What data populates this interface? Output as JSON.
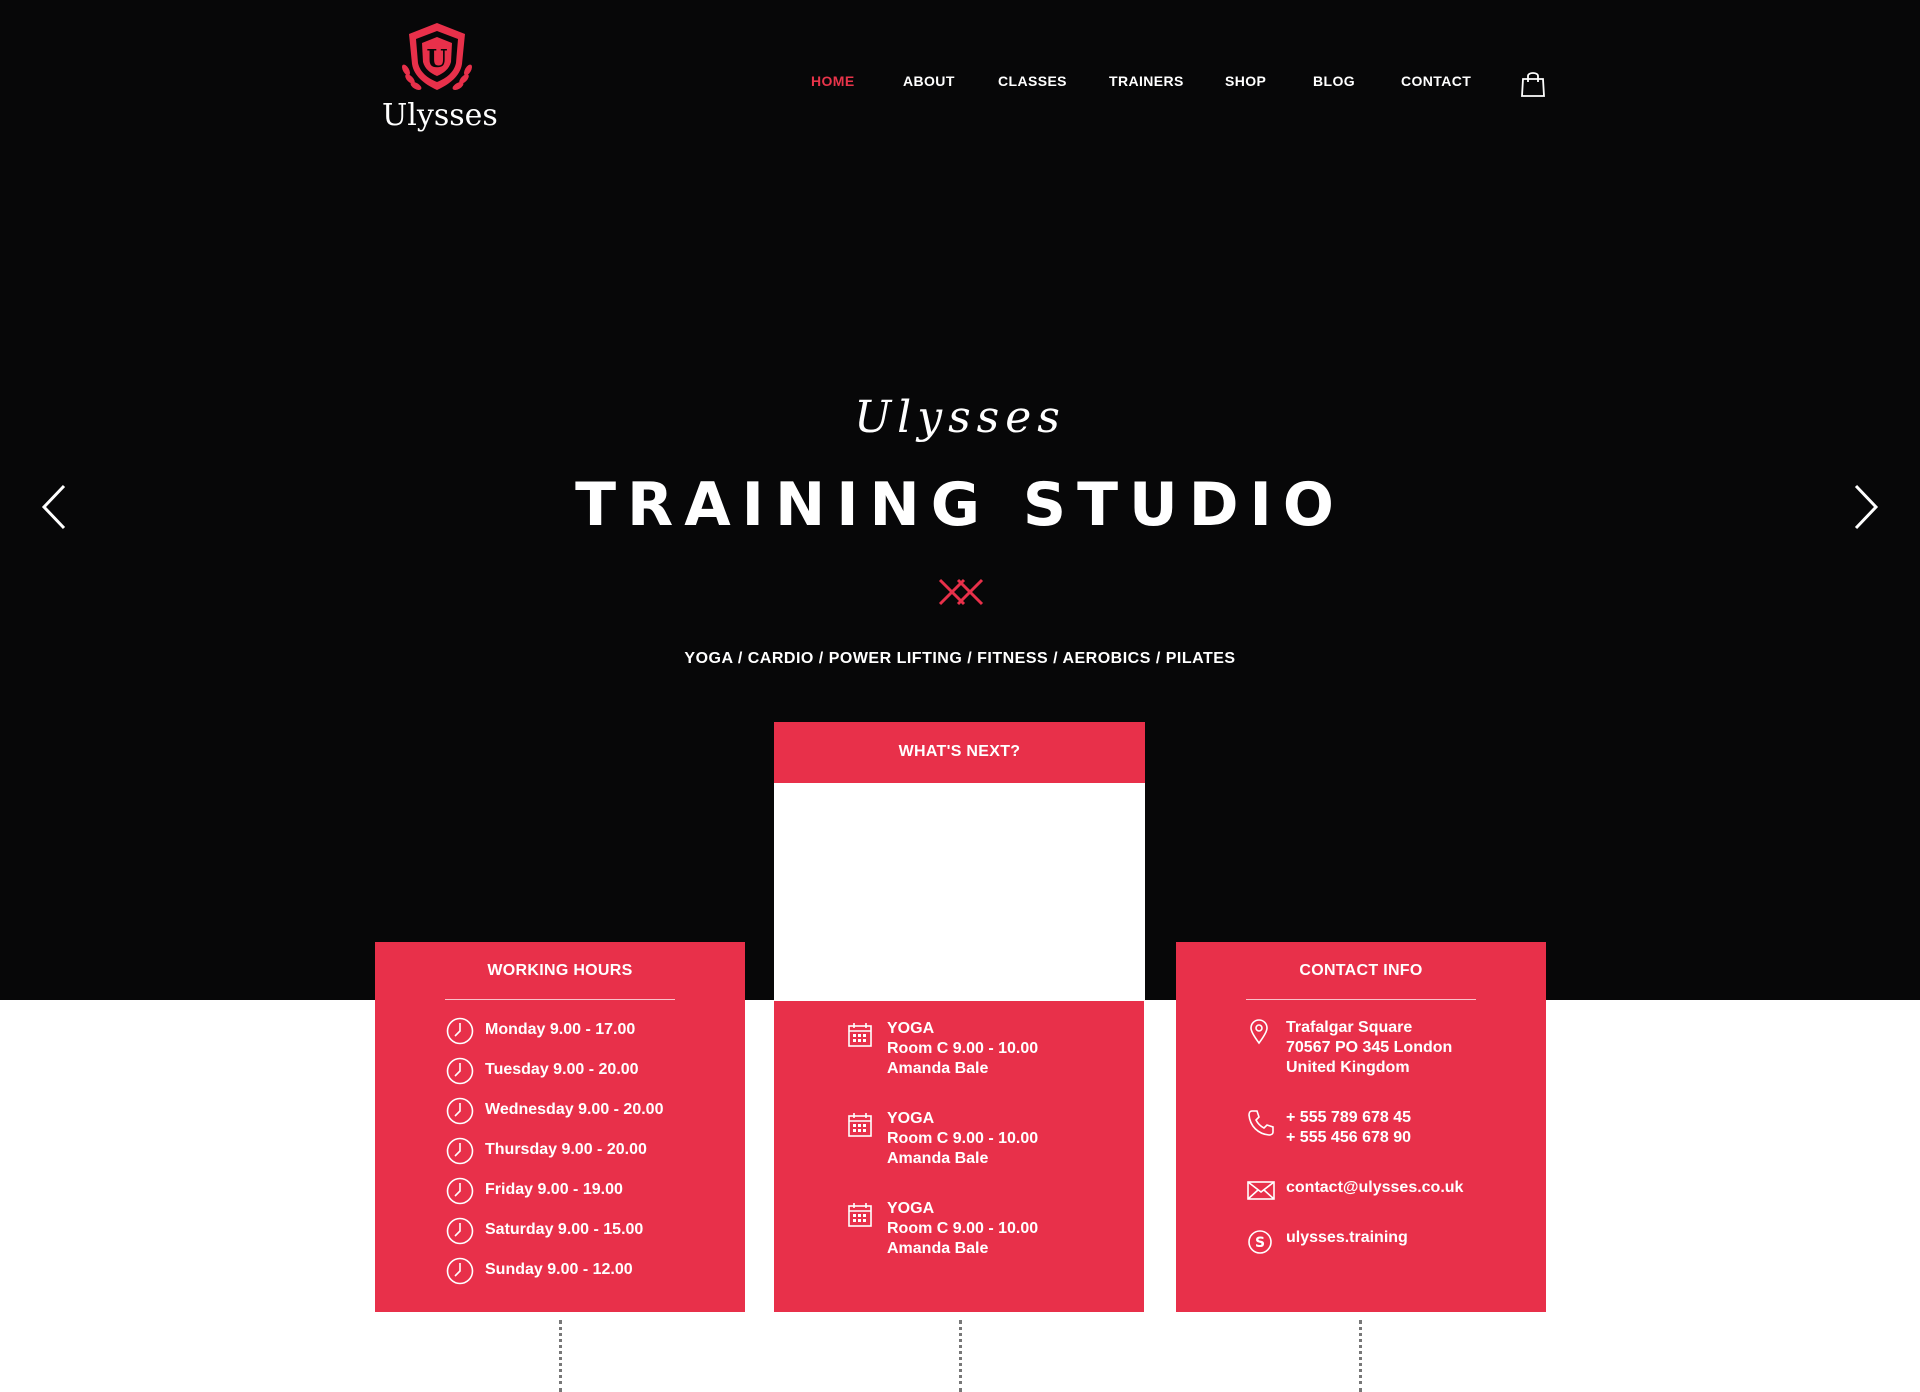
{
  "brand": {
    "logo_letter": "U",
    "name": "Ulysses"
  },
  "nav": {
    "items": [
      {
        "label": "HOME",
        "active": true
      },
      {
        "label": "ABOUT",
        "active": false
      },
      {
        "label": "CLASSES",
        "active": false
      },
      {
        "label": "TRAINERS",
        "active": false
      },
      {
        "label": "SHOP",
        "active": false
      },
      {
        "label": "BLOG",
        "active": false
      },
      {
        "label": "CONTACT",
        "active": false
      }
    ],
    "cart_icon": "shopping-bag-icon"
  },
  "hero": {
    "script_title": "Ulysses",
    "title": "TRAINING STUDIO",
    "subtitle": "YOGA / CARDIO / POWER LIFTING / FITNESS / AEROBICS  / PILATES",
    "prev_icon": "chevron-left-icon",
    "next_icon": "chevron-right-icon"
  },
  "working_hours": {
    "title": "WORKING HOURS",
    "items": [
      "Monday 9.00 - 17.00",
      "Tuesday 9.00 - 20.00",
      "Wednesday 9.00 - 20.00",
      "Thursday 9.00 - 20.00",
      "Friday 9.00 - 19.00",
      "Saturday 9.00 - 15.00",
      "Sunday 9.00 - 12.00"
    ]
  },
  "whats_next": {
    "title": "WHAT'S NEXT?",
    "events": [
      {
        "class": "YOGA",
        "room": "Room C 9.00 - 10.00",
        "trainer": "Amanda Bale"
      },
      {
        "class": "YOGA",
        "room": "Room C 9.00 - 10.00",
        "trainer": "Amanda Bale"
      },
      {
        "class": "YOGA",
        "room": "Room C 9.00 - 10.00",
        "trainer": "Amanda Bale"
      }
    ]
  },
  "contact_info": {
    "title": "CONTACT INFO",
    "address": [
      "Trafalgar Square",
      "70567 PO 345 London",
      "United Kingdom"
    ],
    "phones": [
      "+ 555 789 678 45",
      "+ 555 456 678 90"
    ],
    "email": "contact@ulysses.co.uk",
    "skype": "ulysses.training"
  },
  "colors": {
    "accent": "#e8304a",
    "hero_bg": "#070708",
    "text": "#ffffff"
  }
}
